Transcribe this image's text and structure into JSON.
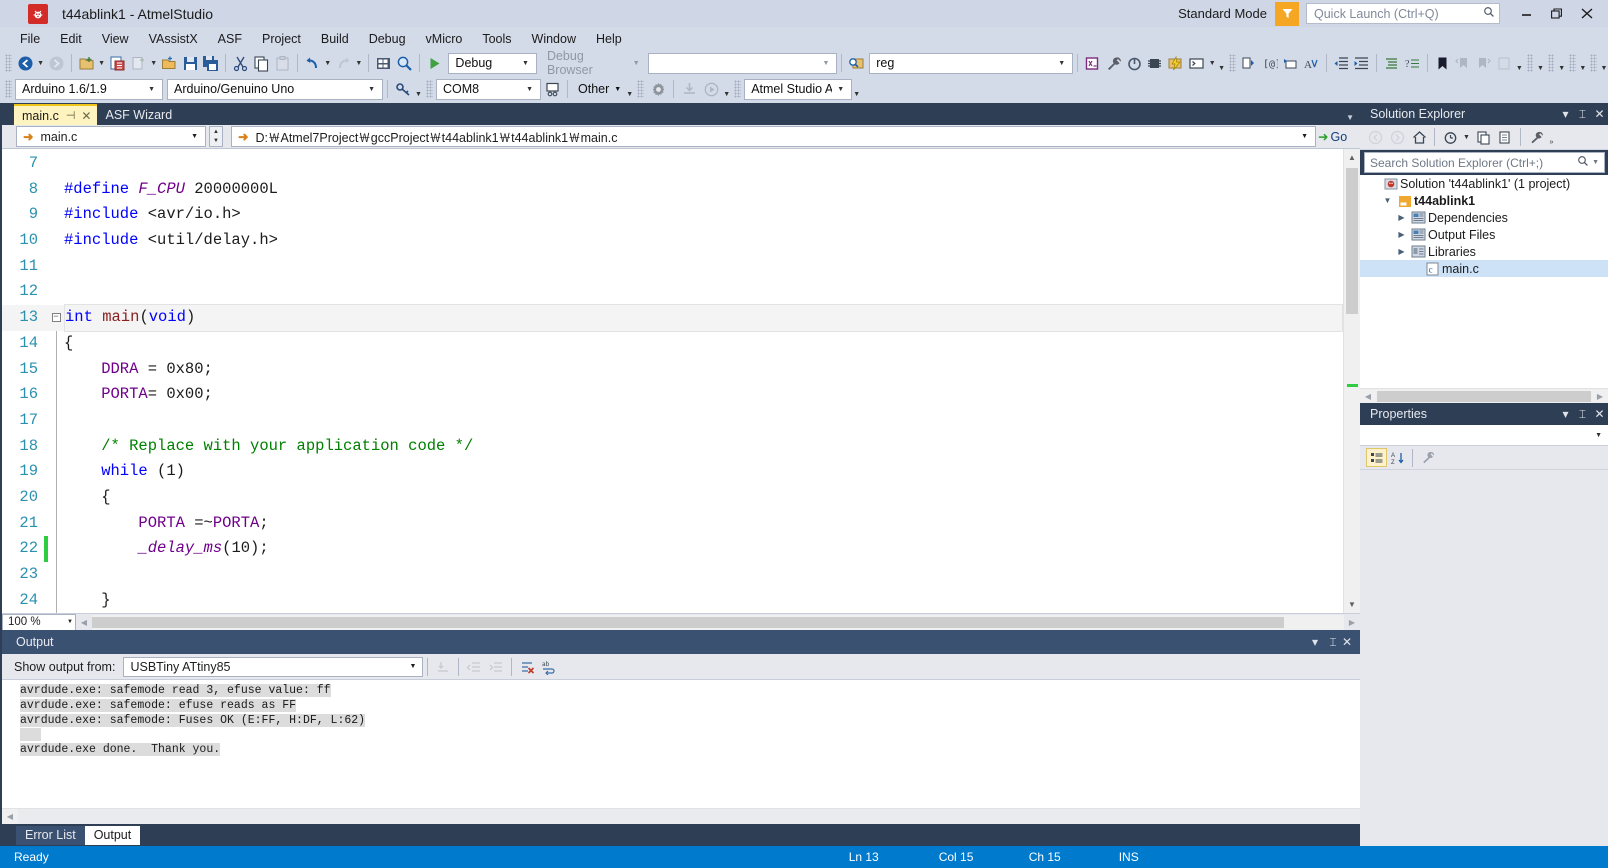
{
  "window": {
    "title": "t44ablink1 - AtmelStudio",
    "logo_icon": "atmel-bug-icon",
    "mode_label": "Standard Mode",
    "funnel_icon": "feedback-funnel-icon",
    "quick_launch_placeholder": "Quick Launch (Ctrl+Q)",
    "search_icon": "search-icon",
    "minimize_label": "—",
    "restore_label": "❐",
    "close_label": "✕"
  },
  "menubar": {
    "items": [
      {
        "label": "File"
      },
      {
        "label": "Edit"
      },
      {
        "label": "View"
      },
      {
        "label": "VAssistX"
      },
      {
        "label": "ASF"
      },
      {
        "label": "Project"
      },
      {
        "label": "Build"
      },
      {
        "label": "Debug"
      },
      {
        "label": "vMicro"
      },
      {
        "label": "Tools"
      },
      {
        "label": "Window"
      },
      {
        "label": "Help"
      }
    ]
  },
  "toolbar_row1": {
    "navigate_back_icon": "navigate-back-icon",
    "navigate_forward_icon": "navigate-forward-icon",
    "new_project_icon": "new-project-icon",
    "add_existing_item_icon": "add-existing-item-icon",
    "new_item_icon": "new-item-icon",
    "open_file_icon": "open-file-icon",
    "save_icon": "save-icon",
    "save_all_icon": "save-all-icon",
    "cut_icon": "cut-icon",
    "copy_icon": "copy-icon",
    "paste_icon": "paste-icon",
    "undo_icon": "undo-icon",
    "redo_icon": "redo-icon",
    "solution_icon": "solution-explorer-icon",
    "find_icon": "find-icon",
    "start_debug_icon": "start-debugging-icon",
    "config_value": "Debug",
    "debug_browser_value": "Debug Browser",
    "empty_combo_value": "",
    "find_symbol_icon": "find-symbol-icon",
    "reg_value": "reg"
  },
  "toolbar_row1_right": {
    "extra_combo_value": "",
    "icons": [
      "atmel-start-icon",
      "wrench-icon",
      "device-programming-icon",
      "device-selection-icon",
      "flash-icon",
      "terminal-icon"
    ],
    "format_icons": [
      "insert-snippet-icon",
      "surround-with-icon",
      "comment-out-icon",
      "uncomment-icon"
    ],
    "indent_icons": [
      "decrease-indent-icon",
      "increase-indent-icon"
    ],
    "list_icons": [
      "toggle-all-outlining-icon",
      "toggle-outlining-icon"
    ],
    "bookmark_icons": [
      "toggle-bookmark-icon",
      "previous-bookmark-icon",
      "next-bookmark-icon",
      "clear-bookmarks-icon"
    ]
  },
  "toolbar_row2": {
    "arduino_version_value": "Arduino 1.6/1.9",
    "board_value": "Arduino/Genuino Uno",
    "key_icon": "key-icon",
    "port_value": "COM8",
    "programmer_icon": "programmer-icon",
    "other_label": "Other",
    "gear_icon": "gear-icon",
    "download_icon": "download-icon",
    "run_icon": "run-icon",
    "tool_value": "Atmel Studio AT"
  },
  "document_tabs": {
    "tabs": [
      {
        "label": "main.c",
        "active": true,
        "pin_icon": "pin-icon",
        "close_icon": "close-icon"
      },
      {
        "label": "ASF Wizard",
        "active": false
      }
    ],
    "overflow_icon": "chevron-down-icon"
  },
  "nav_bar": {
    "scope_value": "main.c",
    "scope_icon": "arrow-right-icon",
    "path_value": "D:￦Atmel7Project￦gccProject￦t44ablink1￦t44ablink1￦main.c",
    "path_icon": "arrow-right-icon",
    "go_label": "Go",
    "go_icon": "go-arrow-icon",
    "spin_up_icon": "chevron-up-icon",
    "spin_down_icon": "chevron-down-icon"
  },
  "editor": {
    "zoom_value": "100 %",
    "lines": [
      {
        "num": "7",
        "tokens": []
      },
      {
        "num": "8",
        "tokens": [
          {
            "t": "#define ",
            "c": "pre"
          },
          {
            "t": "F_CPU",
            "c": "macro"
          },
          {
            "t": " 20000000L",
            "c": "plain"
          }
        ]
      },
      {
        "num": "9",
        "tokens": [
          {
            "t": "#include ",
            "c": "pre"
          },
          {
            "t": "<avr/io.h>",
            "c": "plain"
          }
        ]
      },
      {
        "num": "10",
        "tokens": [
          {
            "t": "#include ",
            "c": "pre"
          },
          {
            "t": "<util/delay.h>",
            "c": "plain"
          }
        ]
      },
      {
        "num": "11",
        "tokens": []
      },
      {
        "num": "12",
        "tokens": []
      },
      {
        "num": "13",
        "fold": true,
        "current": true,
        "tokens": [
          {
            "t": "int ",
            "c": "kw"
          },
          {
            "t": "main",
            "c": "fn"
          },
          {
            "t": "(",
            "c": "plain"
          },
          {
            "t": "void",
            "c": "kw"
          },
          {
            "t": ")",
            "c": "plain"
          }
        ]
      },
      {
        "num": "14",
        "indentbar": true,
        "tokens": [
          {
            "t": "{",
            "c": "plain"
          }
        ]
      },
      {
        "num": "15",
        "indentbar": true,
        "tokens": [
          {
            "t": "    DDRA ",
            "c": "reg"
          },
          {
            "t": "= 0x80;",
            "c": "plain"
          }
        ]
      },
      {
        "num": "16",
        "indentbar": true,
        "tokens": [
          {
            "t": "    PORTA",
            "c": "reg"
          },
          {
            "t": "= 0x00;",
            "c": "plain"
          }
        ]
      },
      {
        "num": "17",
        "indentbar": true,
        "tokens": []
      },
      {
        "num": "18",
        "indentbar": true,
        "tokens": [
          {
            "t": "    /* Replace with your application code */",
            "c": "cmt"
          }
        ]
      },
      {
        "num": "19",
        "indentbar": true,
        "tokens": [
          {
            "t": "    while",
            "c": "kw"
          },
          {
            "t": " (1)",
            "c": "plain"
          }
        ]
      },
      {
        "num": "20",
        "indentbar": true,
        "tokens": [
          {
            "t": "    {",
            "c": "plain"
          }
        ]
      },
      {
        "num": "21",
        "indentbar": true,
        "tokens": [
          {
            "t": "        PORTA",
            "c": "reg"
          },
          {
            "t": " =~",
            "c": "plain"
          },
          {
            "t": "PORTA",
            "c": "reg"
          },
          {
            "t": ";",
            "c": "plain"
          }
        ]
      },
      {
        "num": "22",
        "indentbar": true,
        "changed": true,
        "tokens": [
          {
            "t": "        _delay_ms",
            "c": "macro"
          },
          {
            "t": "(10);",
            "c": "plain"
          }
        ]
      },
      {
        "num": "23",
        "indentbar": true,
        "tokens": []
      },
      {
        "num": "24",
        "indentbar": true,
        "tokens": [
          {
            "t": "    }",
            "c": "plain"
          }
        ]
      }
    ]
  },
  "solution_explorer": {
    "title": "Solution Explorer",
    "head_icons": [
      "chevron-down-icon",
      "pin-icon",
      "close-icon"
    ],
    "toolbar_icons": [
      "back-icon",
      "forward-icon",
      "home-icon",
      "pending-changes-icon",
      "sync-with-active-document-icon",
      "refresh-icon",
      "show-all-files-icon",
      "properties-wrench-icon",
      "overflow-icon"
    ],
    "search_placeholder": "Search Solution Explorer (Ctrl+;)",
    "search_icon": "search-icon",
    "search_dropdown_icon": "chevron-down-icon",
    "tree": [
      {
        "label": "Solution 't44ablink1' (1 project)",
        "icon": "solution-icon",
        "indent": 0,
        "expander": "",
        "bold": false,
        "selected": false
      },
      {
        "label": "t44ablink1",
        "icon": "project-folder-icon",
        "indent": 1,
        "expander": "▼",
        "bold": true,
        "selected": false
      },
      {
        "label": "Dependencies",
        "icon": "dependencies-icon",
        "indent": 2,
        "expander": "▶",
        "bold": false,
        "selected": false
      },
      {
        "label": "Output Files",
        "icon": "output-files-icon",
        "indent": 2,
        "expander": "▶",
        "bold": false,
        "selected": false
      },
      {
        "label": "Libraries",
        "icon": "libraries-icon",
        "indent": 2,
        "expander": "▶",
        "bold": false,
        "selected": false
      },
      {
        "label": "main.c",
        "icon": "c-file-icon",
        "indent": 3,
        "expander": "",
        "bold": false,
        "selected": true
      }
    ]
  },
  "properties_panel": {
    "title": "Properties",
    "head_icons": [
      "chevron-down-icon",
      "pin-icon",
      "close-icon"
    ],
    "selector_value": "",
    "selector_icon": "chevron-down-icon",
    "tool_icons": [
      "categorized-icon",
      "alphabetical-icon",
      "property-pages-icon"
    ]
  },
  "output_panel": {
    "title": "Output",
    "head_icons": [
      "chevron-down-icon",
      "pin-icon",
      "close-icon"
    ],
    "show_output_label": "Show output from:",
    "source_value": "USBTiny ATtiny85",
    "toolbar_icons": [
      "find-message-icon",
      "go-to-previous-message-icon",
      "go-to-next-message-icon",
      "clear-all-icon",
      "toggle-word-wrap-icon"
    ],
    "lines": [
      "avrdude.exe: safemode read 3, efuse value: ff",
      "avrdude.exe: safemode: efuse reads as FF",
      "avrdude.exe: safemode: Fuses OK (E:FF, H:DF, L:62)",
      "",
      "avrdude.exe done.  Thank you."
    ]
  },
  "bottom_tabs": {
    "tabs": [
      {
        "label": "Error List",
        "active": false
      },
      {
        "label": "Output",
        "active": true
      }
    ]
  },
  "statusbar": {
    "status": "Ready",
    "line": "Ln 13",
    "column": "Col 15",
    "character": "Ch 15",
    "insert_mode": "INS"
  },
  "colors": {
    "accent_blue": "#007acc",
    "titlebar": "#cfd6e5",
    "panel_dark": "#2d3e55",
    "tab_active": "#fff4bf",
    "highlight_orange": "#f5a623"
  }
}
